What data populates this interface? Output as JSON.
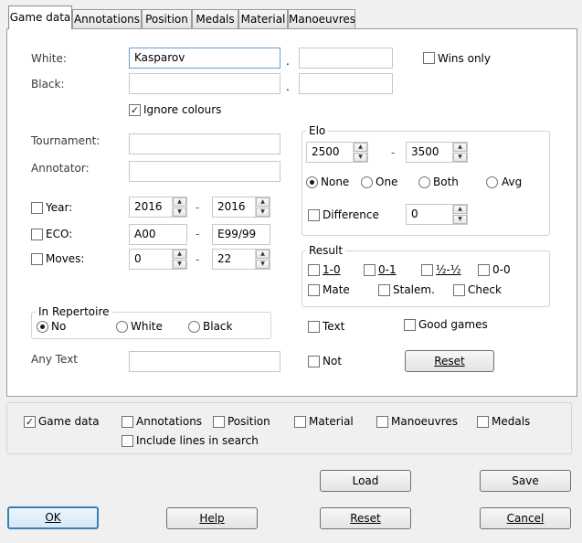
{
  "tabs": [
    "Game data",
    "Annotations",
    "Position",
    "Medals",
    "Material",
    "Manoeuvres"
  ],
  "players": {
    "white_label": "White:",
    "white_value": "Kasparov",
    "white_first": "",
    "black_label": "Black:",
    "black_value": "",
    "black_first": "",
    "sep": ".",
    "wins_only": "Wins only",
    "ignore_colours": "Ignore colours"
  },
  "fields": {
    "tournament_label": "Tournament:",
    "annotator_label": "Annotator:",
    "year_label": "Year:",
    "year_from": "2016",
    "year_to": "2016",
    "eco_label": "ECO:",
    "eco_from": "A00",
    "eco_to": "E99/99",
    "moves_label": "Moves:",
    "moves_from": "0",
    "moves_to": "22",
    "dash": "-"
  },
  "elo": {
    "title": "Elo",
    "from": "2500",
    "to": "3500",
    "dash": "-",
    "options": [
      "None",
      "One",
      "Both",
      "Avg"
    ],
    "selected": "None",
    "difference_label": "Difference",
    "difference_value": "0"
  },
  "result": {
    "title": "Result",
    "items": [
      "1-0",
      "0-1",
      "½-½",
      "0-0",
      "Mate",
      "Stalem.",
      "Check"
    ]
  },
  "repertoire": {
    "title": "In Repertoire",
    "options": [
      "No",
      "White",
      "Black"
    ],
    "selected": "No"
  },
  "text_section": {
    "text_label": "Text",
    "good_games": "Good games",
    "any_text_label": "Any Text",
    "not_label": "Not",
    "reset_label": "Reset"
  },
  "search_in": {
    "items": [
      "Game data",
      "Annotations",
      "Position",
      "Material",
      "Manoeuvres",
      "Medals"
    ],
    "checked": [
      "Game data"
    ],
    "include_lines": "Include lines in search"
  },
  "buttons": {
    "load": "Load",
    "save": "Save",
    "ok": "OK",
    "help": "Help",
    "reset": "Reset",
    "cancel": "Cancel"
  },
  "colors": {
    "focus_border": "#6a9bd8",
    "default_button_border": "#3c7fb1"
  }
}
